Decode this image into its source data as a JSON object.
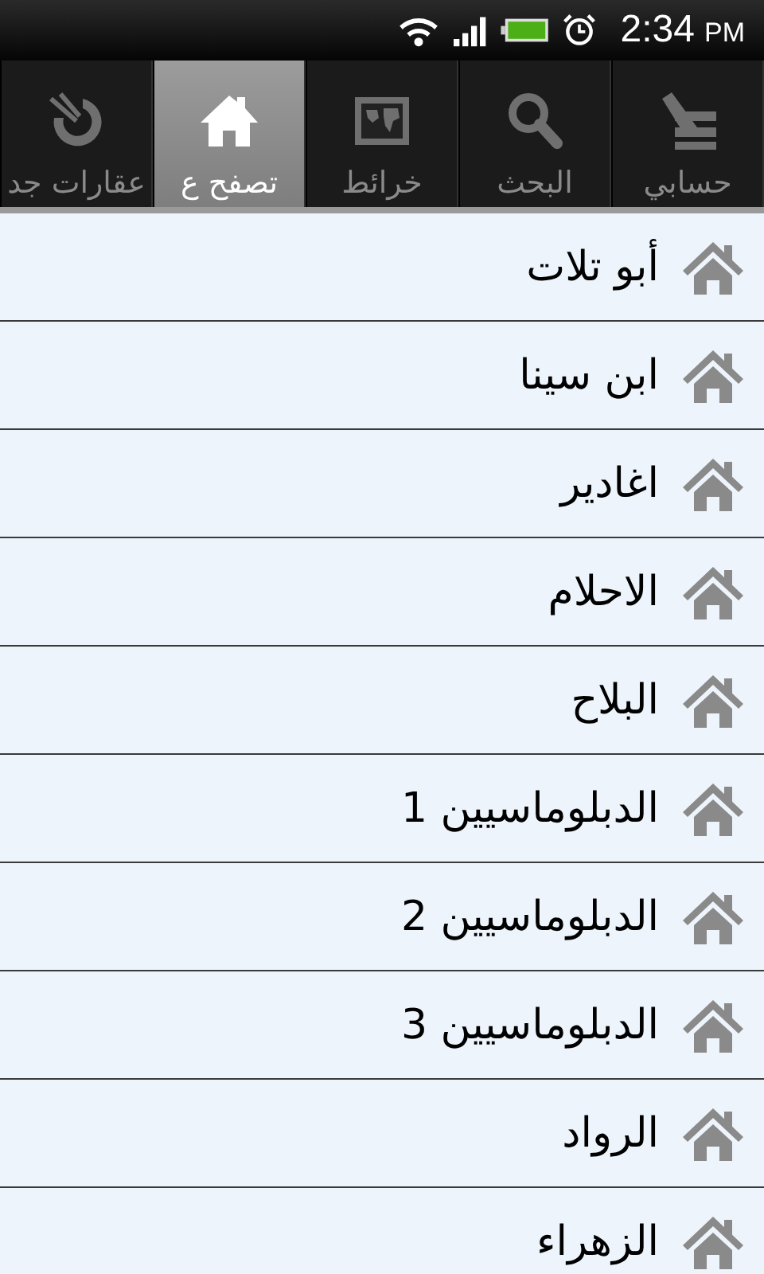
{
  "status_bar": {
    "time": "2:34",
    "ampm": "PM"
  },
  "tabs": [
    {
      "label": "حسابي",
      "kind": "account",
      "selected": false
    },
    {
      "label": "البحث",
      "kind": "search",
      "selected": false
    },
    {
      "label": "خرائط",
      "kind": "map",
      "selected": false
    },
    {
      "label": "تصفح ع",
      "kind": "home",
      "selected": true
    },
    {
      "label": "عقارات جد",
      "kind": "new",
      "selected": false
    }
  ],
  "list": {
    "items": [
      "أبو تلات",
      "ابن سينا",
      "اغادير",
      "الاحلام",
      "البلاح",
      "الدبلوماسيين 1",
      "الدبلوماسيين 2",
      "الدبلوماسيين 3",
      "الرواد",
      "الزهراء"
    ]
  }
}
